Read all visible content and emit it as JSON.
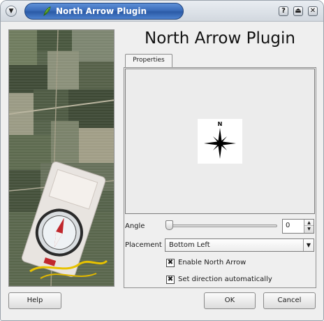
{
  "window": {
    "title": "North Arrow Plugin",
    "controls": {
      "help": "?",
      "shade": "⏏",
      "close": "✕"
    }
  },
  "heading": "North Arrow Plugin",
  "tabs": [
    {
      "label": "Properties"
    }
  ],
  "preview": {
    "north_label": "N"
  },
  "angle": {
    "label": "Angle",
    "value": "0",
    "slider_fraction": 0
  },
  "placement": {
    "label": "Placement",
    "selected": "Bottom Left"
  },
  "options": {
    "enable_north_arrow": {
      "label": "Enable North Arrow",
      "checked": true
    },
    "set_direction_auto": {
      "label": "Set direction automatically",
      "checked": true
    }
  },
  "buttons": {
    "help": "Help",
    "ok": "OK",
    "cancel": "Cancel"
  },
  "icons": {
    "window_menu": "chevron-down-icon",
    "app": "qgis-leaf-icon",
    "check": "x-check-icon"
  },
  "colors": {
    "title_blue": "#3a6cba",
    "dialog_bg": "#efefef",
    "check_mark": "#111111"
  }
}
